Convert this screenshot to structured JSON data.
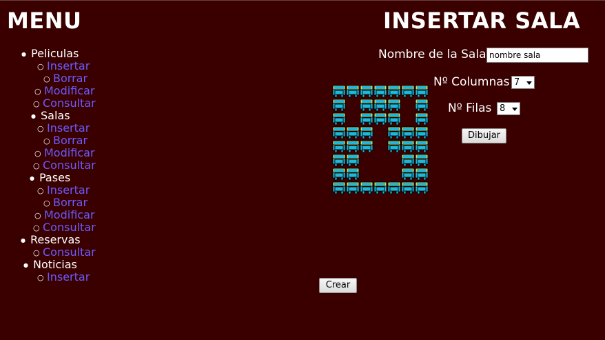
{
  "menu": {
    "title": "MENU",
    "sections": [
      {
        "label": "Peliculas",
        "links": [
          "Insertar",
          "Borrar",
          "Modificar",
          "Consultar"
        ]
      },
      {
        "label": "Salas",
        "links": [
          "Insertar",
          "Borrar",
          "Modificar",
          "Consultar"
        ]
      },
      {
        "label": "Pases",
        "links": [
          "Insertar",
          "Borrar",
          "Modificar",
          "Consultar"
        ]
      },
      {
        "label": "Reservas",
        "links": [
          "Consultar"
        ]
      },
      {
        "label": "Noticias",
        "links": [
          "Insertar"
        ]
      }
    ]
  },
  "form": {
    "title": "INSERTAR SALA",
    "name_label": "Nombre de la Sala",
    "name_value": "nombre sala",
    "columns_label": "Nº Columnas",
    "columns_value": "7",
    "rows_label": "Nº Filas",
    "rows_value": "8",
    "draw_button": "Dibujar",
    "create_button": "Crear"
  },
  "seat_grid": {
    "columns": 7,
    "rows": 8,
    "layout": [
      "SSSSSSS",
      "S.SSS.S",
      "S.SSS.S",
      "SSS.SSS",
      "SSS.SSS",
      "SS...SS",
      "SS...SS",
      "SSSSSSS"
    ]
  },
  "colors": {
    "background": "#3a0000",
    "link": "#6a5cff",
    "seat_body": "#1fb8d8",
    "seat_back": "#e8d84a"
  }
}
